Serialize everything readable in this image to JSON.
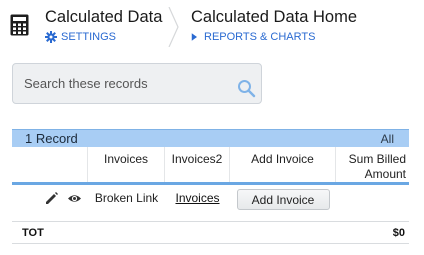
{
  "header": {
    "app_title": "Calculated Data",
    "settings_label": "SETTINGS",
    "page_title": "Calculated Data Home",
    "reports_label": "REPORTS & CHARTS"
  },
  "search": {
    "placeholder": "Search these records"
  },
  "table": {
    "record_count": "1 Record",
    "all_label": "All",
    "columns": [
      "Invoices",
      "Invoices2",
      "Add Invoice",
      "Sum Billed Amount"
    ],
    "rows": [
      {
        "invoices": "Broken Link",
        "invoices2": "Invoices",
        "add_invoice": "Add  Invoice"
      }
    ],
    "total_label": "TOT",
    "total_value": "$0"
  },
  "colors": {
    "accent": "#2a6ad1",
    "summary_bg": "#a8cdf4",
    "header_rule": "#6aa7e3"
  },
  "icons": [
    "calculator-icon",
    "gear-icon",
    "triangle-right-icon",
    "search-icon",
    "pencil-icon",
    "eye-icon"
  ]
}
